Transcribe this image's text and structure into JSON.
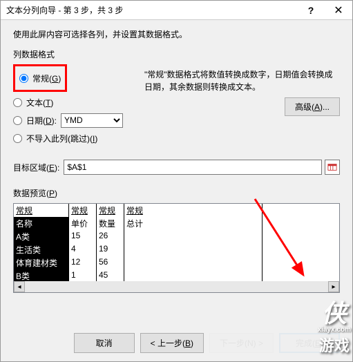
{
  "title": "文本分列向导 - 第 3 步，共 3 步",
  "instruction": "使用此屏内容可选择各列，并设置其数据格式。",
  "section_label": "列数据格式",
  "radios": {
    "general": "常规(G)",
    "text": "文本(T)",
    "date": "日期(D):",
    "skip": "不导入此列(跳过)(I)"
  },
  "date_format": "YMD",
  "description": "\"常规\"数据格式将数值转换成数字，日期值会转换成日期，其余数据则转换成文本。",
  "advanced_btn": "高级(A)...",
  "target_label": "目标区域(E):",
  "target_value": "$A$1",
  "preview_label": "数据预览(P)",
  "preview": {
    "headers": [
      "常规",
      "常规",
      "常规",
      "常规"
    ],
    "rows": [
      [
        "名称",
        "单价",
        "数量",
        "总计"
      ],
      [
        "A类",
        "15",
        "26",
        ""
      ],
      [
        "生活类",
        "4",
        "19",
        ""
      ],
      [
        "体育建材类",
        "12",
        "56",
        ""
      ],
      [
        "B类",
        "1",
        "45",
        ""
      ]
    ]
  },
  "buttons": {
    "cancel": "取消",
    "back": "< 上一步(B)",
    "next": "下一步(N) >",
    "finish": "完成(E)"
  },
  "watermark": {
    "brand": "侠",
    "url": "xiayx.com",
    "sub": "游戏"
  }
}
